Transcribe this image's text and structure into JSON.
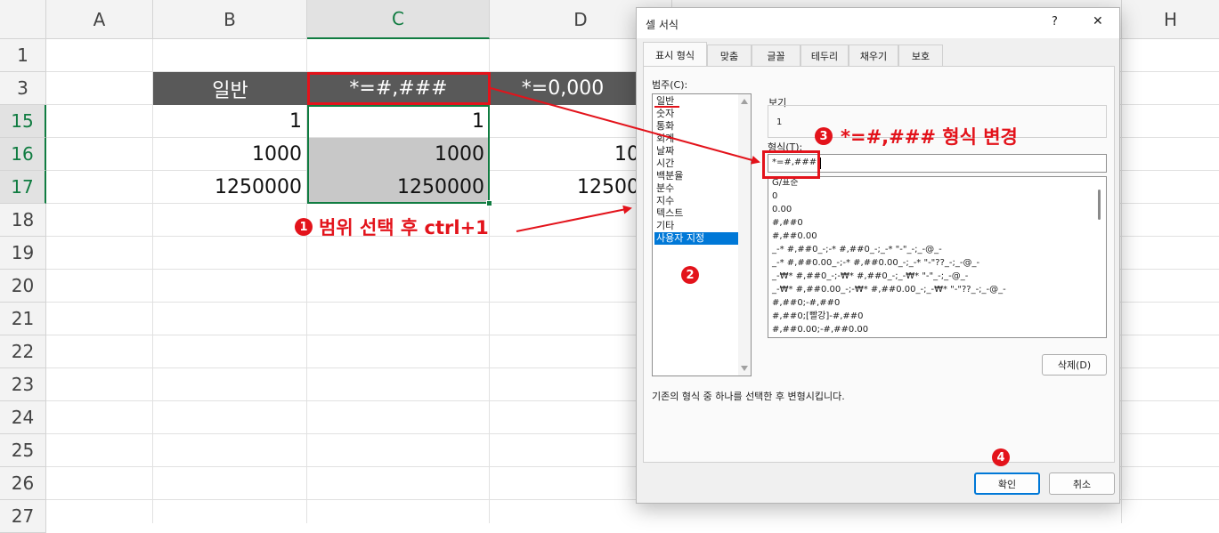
{
  "sheet": {
    "columns": [
      "A",
      "B",
      "C",
      "D",
      "H"
    ],
    "rows": [
      "1",
      "3",
      "15",
      "16",
      "17",
      "18",
      "19",
      "20",
      "21",
      "22",
      "23",
      "24",
      "25",
      "26",
      "27"
    ],
    "cells": {
      "b3": "일반",
      "c3": "*=#,###",
      "d3": "*=0,000",
      "b15": "1",
      "c15": "1",
      "b16": "1000",
      "c16": "1000",
      "d16": "10",
      "b17": "1250000",
      "c17": "1250000",
      "d17": "12500"
    }
  },
  "dialog": {
    "title": "셀 서식",
    "help_label": "?",
    "close_label": "✕",
    "tabs": [
      "표시 형식",
      "맞춤",
      "글꼴",
      "테두리",
      "채우기",
      "보호"
    ],
    "category_label": "범주(C):",
    "categories": [
      "일반",
      "숫자",
      "통화",
      "회계",
      "날짜",
      "시간",
      "백분율",
      "분수",
      "지수",
      "텍스트",
      "기타",
      "사용자 지정"
    ],
    "selected_category": "사용자 지정",
    "sample_label": "보기",
    "sample_value": "1",
    "type_label": "형식(T):",
    "type_value": "*=#,###",
    "formats": [
      "G/표준",
      "0",
      "0.00",
      "#,##0",
      "#,##0.00",
      "_-* #,##0_-;-* #,##0_-;_-* \"-\"_-;_-@_-",
      "_-* #,##0.00_-;-* #,##0.00_-;_-* \"-\"??_-;_-@_-",
      "_-₩* #,##0_-;-₩* #,##0_-;_-₩* \"-\"_-;_-@_-",
      "_-₩* #,##0.00_-;-₩* #,##0.00_-;_-₩* \"-\"??_-;_-@_-",
      "#,##0;-#,##0",
      "#,##0;[빨강]-#,##0",
      "#,##0.00;-#,##0.00"
    ],
    "delete_label": "삭제(D)",
    "description": "기존의 형식 중 하나를 선택한 후 변형시킵니다.",
    "ok_label": "확인",
    "cancel_label": "취소"
  },
  "annotations": {
    "step1_number": "1",
    "step1_text": "범위 선택 후 ctrl+1",
    "step2_number": "2",
    "step3_number": "3",
    "step3_text": "*=#,### 형식 변경",
    "step4_number": "4",
    "color": "#e3131b"
  },
  "colors": {
    "header_fill": "#595959",
    "selection_fill": "#c8c8c8",
    "excel_green": "#107c41",
    "list_selection": "#0078d7"
  }
}
